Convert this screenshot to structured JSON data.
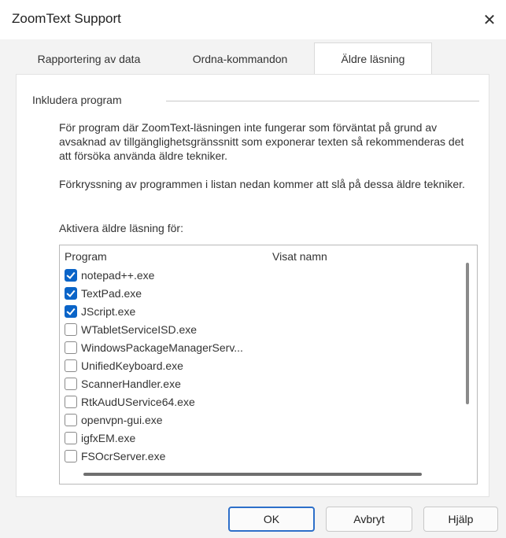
{
  "window": {
    "title": "ZoomText Support",
    "close_glyph": "✕"
  },
  "tabs": [
    {
      "label": "Rapportering av data",
      "selected": false
    },
    {
      "label": "Ordna-kommandon",
      "selected": false
    },
    {
      "label": "Äldre läsning",
      "selected": true
    }
  ],
  "panel": {
    "group_label": "Inkludera program",
    "paragraph1": "För program där ZoomText-läsningen inte fungerar som förväntat på grund av avsaknad av tillgänglighetsgränssnitt som exponerar texten så rekommenderas det att försöka använda äldre tekniker.",
    "paragraph2": "Förkryssning av programmen i listan nedan kommer att slå på dessa äldre tekniker.",
    "list_label": "Aktivera äldre läsning för:"
  },
  "list": {
    "columns": [
      "Program",
      "Visat namn"
    ],
    "rows": [
      {
        "name": "notepad++.exe",
        "checked": true
      },
      {
        "name": "TextPad.exe",
        "checked": true
      },
      {
        "name": "JScript.exe",
        "checked": true
      },
      {
        "name": "WTabletServiceISD.exe",
        "checked": false
      },
      {
        "name": "WindowsPackageManagerServ...",
        "checked": false
      },
      {
        "name": "UnifiedKeyboard.exe",
        "checked": false
      },
      {
        "name": "ScannerHandler.exe",
        "checked": false
      },
      {
        "name": "RtkAudUService64.exe",
        "checked": false
      },
      {
        "name": "openvpn-gui.exe",
        "checked": false
      },
      {
        "name": "igfxEM.exe",
        "checked": false
      },
      {
        "name": "FSOcrServer.exe",
        "checked": false
      }
    ]
  },
  "buttons": {
    "ok": "OK",
    "cancel": "Avbryt",
    "help": "Hjälp"
  }
}
